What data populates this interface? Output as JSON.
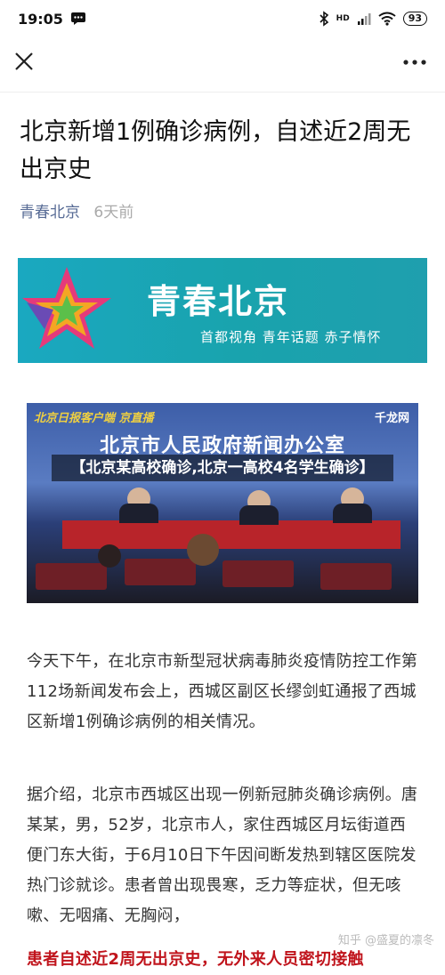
{
  "status_bar": {
    "time": "19:05",
    "network": "HD",
    "battery": "93"
  },
  "nav": {
    "close_icon": "close-icon",
    "more_icon": "more-icon"
  },
  "article": {
    "title": "北京新增1例确诊病例，自述近2周无出京史",
    "author": "青春北京",
    "time": "6天前"
  },
  "banner": {
    "name": "青春北京",
    "slogan": "首都视角  青年话题  赤子情怀"
  },
  "photo": {
    "top_logos": "北京日报客户端  京直播",
    "qianlong": "千龙网",
    "office_title": "北京市人民政府新闻办公室",
    "caption": "【北京某高校确诊,北京一高校4名学生确诊】"
  },
  "paragraphs": {
    "p1": "今天下午，在北京市新型冠状病毒肺炎疫情防控工作第112场新闻发布会上，西城区副区长缪剑虹通报了西城区新增1例确诊病例的相关情况。",
    "p2": "据介绍，北京市西城区出现一例新冠肺炎确诊病例。唐某某，男，52岁，北京市人，家住西城区月坛街道西便门东大街，于6月10日下午因间断发热到辖区医院发热门诊就诊。患者曾出现畏寒，乏力等症状，但无咳嗽、无咽痛、无胸闷，",
    "p3": "患者自述近2周无出京史，无外来人员密切接触"
  },
  "watermark": "知乎 @盛夏的凛冬",
  "colors": {
    "link": "#576b95",
    "banner": "#1aa8c0",
    "highlight_red": "#c0141c"
  }
}
